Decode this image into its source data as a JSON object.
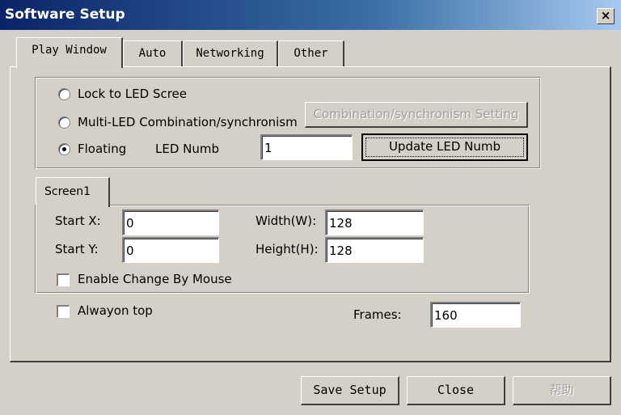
{
  "window": {
    "title": "Software Setup",
    "close_glyph": "×"
  },
  "tabs": [
    {
      "label": "Play Window",
      "active": true
    },
    {
      "label": "Auto"
    },
    {
      "label": "Networking"
    },
    {
      "label": "Other"
    }
  ],
  "display_mode": {
    "options": [
      {
        "label": "Lock to LED Scree",
        "selected": false
      },
      {
        "label": "Multi-LED Combination/synchronism",
        "selected": false
      },
      {
        "label": "Floating",
        "selected": true
      }
    ],
    "combination_button": "Combination/synchronism Setting",
    "led_numb_label": "LED Numb",
    "led_numb_value": "1",
    "update_button": "Update LED Numb"
  },
  "screen": {
    "tab_label": "Screen1",
    "start_x_label": "Start X:",
    "start_x_value": "0",
    "start_y_label": "Start Y:",
    "start_y_value": "0",
    "width_label": "Width(W):",
    "width_value": "128",
    "height_label": "Height(H):",
    "height_value": "128",
    "enable_mouse_label": "Enable Change By Mouse",
    "enable_mouse_checked": false
  },
  "alwayson_label": "Alwayon top",
  "alwayson_checked": false,
  "frames_label": "Frames:",
  "frames_value": "160",
  "buttons": {
    "save": "Save Setup",
    "close": "Close",
    "help": "帮助"
  }
}
